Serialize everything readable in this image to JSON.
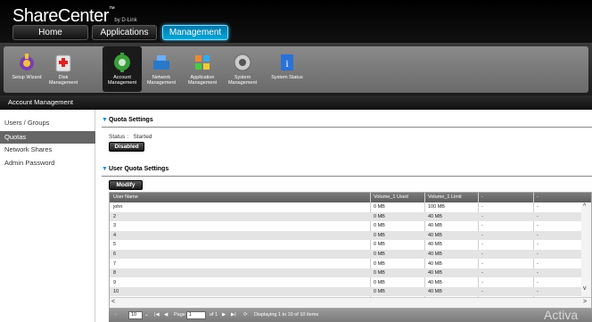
{
  "header": {
    "logo": "ShareCenter",
    "logo_tm": "™",
    "logo_by": "by D-Link",
    "tabs": [
      {
        "label": "Home"
      },
      {
        "label": "Applications"
      },
      {
        "label": "Management"
      }
    ]
  },
  "toolbar": {
    "items": [
      {
        "label1": "Setup Wizard",
        "label2": "",
        "icon": "wizard-icon"
      },
      {
        "label1": "Disk",
        "label2": "Management",
        "icon": "disk-icon"
      },
      {
        "label1": "Account",
        "label2": "Management",
        "icon": "account-icon"
      },
      {
        "label1": "Network",
        "label2": "Management",
        "icon": "network-icon"
      },
      {
        "label1": "Application",
        "label2": "Management",
        "icon": "application-icon"
      },
      {
        "label1": "System",
        "label2": "Management",
        "icon": "system-icon"
      },
      {
        "label1": "System Status",
        "label2": "",
        "icon": "info-icon"
      }
    ]
  },
  "section_bar": {
    "title": "Account Management"
  },
  "sidebar": {
    "items": [
      {
        "label": "Users / Groups"
      },
      {
        "label": "Quotas"
      },
      {
        "label": "Network Shares"
      },
      {
        "label": "Admin Password"
      }
    ]
  },
  "quota_settings": {
    "title": "Quota Settings",
    "status_label": "Status :",
    "status_value": "Started",
    "disabled_button": "Disabled"
  },
  "user_quota": {
    "title": "User Quota Settings",
    "modify_button": "Modify",
    "columns": [
      "User Name",
      "Volume_1  Used",
      "Volume_1  Limit",
      "-",
      "-"
    ],
    "rows": [
      [
        "john",
        "0 MB",
        "100 MB",
        "-",
        "-"
      ],
      [
        "2",
        "0 MB",
        "40 MB",
        "-",
        "-"
      ],
      [
        "3",
        "0 MB",
        "40 MB",
        "-",
        "-"
      ],
      [
        "4",
        "0 MB",
        "40 MB",
        "-",
        "-"
      ],
      [
        "5",
        "0 MB",
        "40 MB",
        "-",
        "-"
      ],
      [
        "6",
        "0 MB",
        "40 MB",
        "-",
        "-"
      ],
      [
        "7",
        "0 MB",
        "40 MB",
        "-",
        "-"
      ],
      [
        "8",
        "0 MB",
        "40 MB",
        "-",
        "-"
      ],
      [
        "9",
        "0 MB",
        "40 MB",
        "-",
        "-"
      ],
      [
        "10",
        "0 MB",
        "40 MB",
        "-",
        "-"
      ]
    ]
  },
  "pager": {
    "page_size": "10",
    "page_label": "Page",
    "page_value": "1",
    "of_label": "of 1",
    "display_text": "Displaying 1 to 10 of 10 items"
  },
  "watermark": "Activa",
  "colors": {
    "accent": "#1a8ed8",
    "active_tab": "#00a7d8",
    "selected_side": "#666666"
  }
}
